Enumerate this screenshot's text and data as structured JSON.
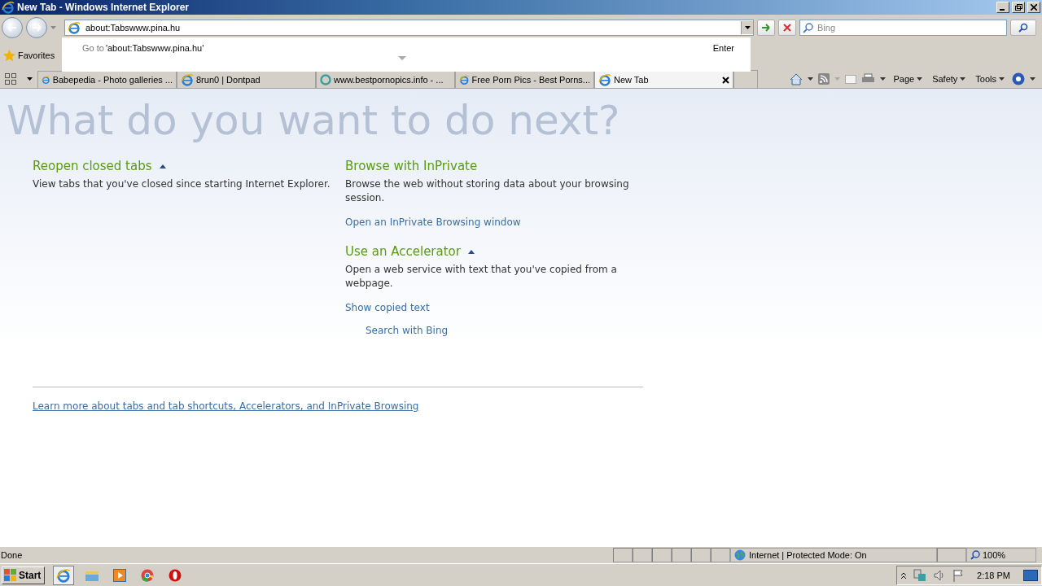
{
  "window": {
    "title": "New Tab - Windows Internet Explorer"
  },
  "address": {
    "value": "about:Tabswww.pina.hu"
  },
  "suggestion": {
    "prefix": "Go to",
    "url": "'about:Tabswww.pina.hu'",
    "hint": "Enter"
  },
  "search": {
    "placeholder": "Bing"
  },
  "favorites": {
    "label": "Favorites"
  },
  "tabs": [
    {
      "label": "Babepedia - Photo galleries ...",
      "selected": false,
      "kind": "page"
    },
    {
      "label": "8run0 | Dontpad",
      "selected": false,
      "kind": "page"
    },
    {
      "label": "www.bestpornopics.info - ...",
      "selected": false,
      "kind": "loading"
    },
    {
      "label": "Free Porn Pics - Best Porns...",
      "selected": false,
      "kind": "page"
    },
    {
      "label": "New Tab",
      "selected": true,
      "kind": "page"
    }
  ],
  "command_bar": [
    "Page",
    "Safety",
    "Tools"
  ],
  "content": {
    "heading": "What do you want to do next?",
    "left": [
      {
        "title": "Reopen closed tabs",
        "kind": "toggle",
        "description": "View tabs that you've closed since starting Internet Explorer."
      }
    ],
    "right": [
      {
        "title": "Browse with InPrivate",
        "kind": "plain",
        "description": "Browse the web without storing data about your browsing session.",
        "link": "Open an InPrivate Browsing window"
      },
      {
        "title": "Use an Accelerator",
        "kind": "toggle",
        "description": "Open a web service with text that you've copied from a webpage.",
        "link": "Show copied text",
        "accelerators": [
          "Search with Bing"
        ]
      }
    ],
    "footer_link": "Learn more about tabs and tab shortcuts, Accelerators, and InPrivate Browsing"
  },
  "status_bar": {
    "text": "Done",
    "zone": "Internet | Protected Mode: On",
    "zoom": "100%"
  },
  "taskbar": {
    "start": "Start",
    "clock": "2:18 PM"
  }
}
